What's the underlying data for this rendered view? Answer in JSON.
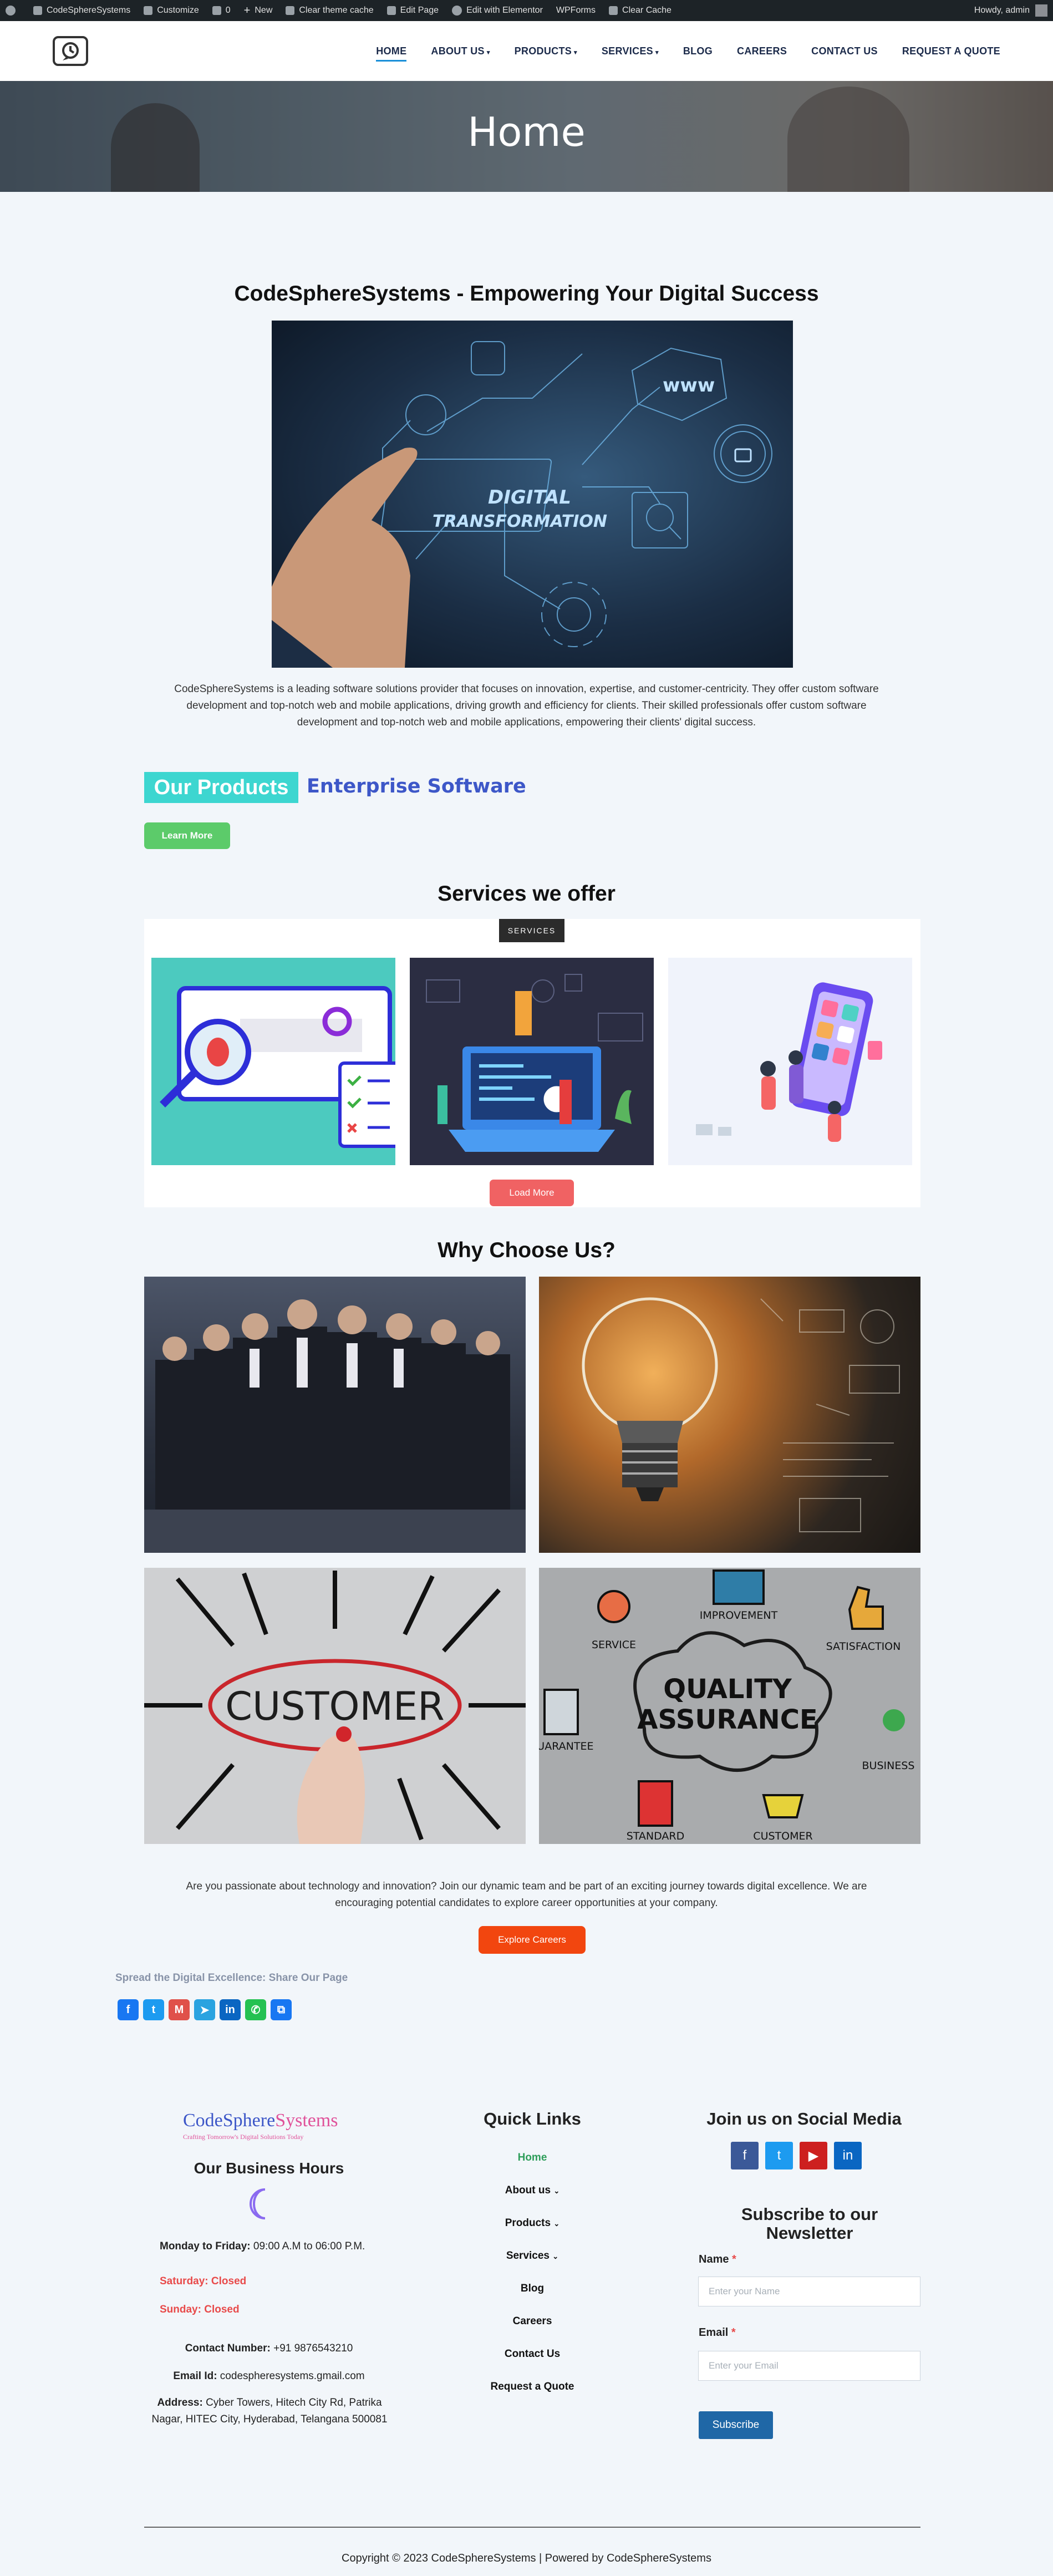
{
  "admin_bar": {
    "site_name": "CodeSphereSystems",
    "customize": "Customize",
    "comments": "0",
    "new": "New",
    "clear_theme_cache": "Clear theme cache",
    "edit_page": "Edit Page",
    "edit_elementor": "Edit with Elementor",
    "wpforms": "WPForms",
    "clear_cache": "Clear Cache",
    "howdy": "Howdy, admin"
  },
  "nav": {
    "items": [
      {
        "label": "HOME",
        "active": true
      },
      {
        "label": "ABOUT US",
        "has_dropdown": true
      },
      {
        "label": "PRODUCTS",
        "has_dropdown": true
      },
      {
        "label": "SERVICES",
        "has_dropdown": true
      },
      {
        "label": "BLOG"
      },
      {
        "label": "CAREERS"
      },
      {
        "label": "CONTACT US"
      },
      {
        "label": "REQUEST A QUOTE"
      }
    ]
  },
  "hero": {
    "title": "Home"
  },
  "main": {
    "title": "CodeSphereSystems - Empowering Your Digital Success",
    "image_text_1": "DIGITAL",
    "image_text_2": "TRANSFORMATION",
    "image_www": "www",
    "intro": "CodeSphereSystems is a leading software solutions provider that focuses on innovation, expertise, and customer-centricity. They offer custom software development and top-notch web and mobile applications, driving growth and efficiency for clients. Their skilled professionals offer custom software development and top-notch web and mobile applications, empowering their clients' digital success."
  },
  "products": {
    "badge": "Our Products",
    "headline": "Enterprise Software",
    "learn_more": "Learn More"
  },
  "services": {
    "title": "Services we offer",
    "badge": "SERVICES",
    "load_more": "Load More"
  },
  "why": {
    "title": "Why Choose Us?",
    "customer_word": "CUSTOMER",
    "qa_line1": "QUALITY",
    "qa_line2": "ASSURANCE",
    "qa_labels": [
      "SERVICE",
      "IMPROVEMENT",
      "SATISFACTION",
      "GUARANTEE",
      "BUSINESS",
      "STANDARD",
      "CUSTOMER"
    ]
  },
  "careers": {
    "text": "Are you passionate about technology and innovation? Join our dynamic team and be part of an exciting journey towards digital excellence. We are encouraging potential candidates to explore career opportunities at your company.",
    "button": "Explore Careers"
  },
  "share": {
    "title": "Spread the Digital Excellence: Share Our Page"
  },
  "footer": {
    "logo_a": "CodeSphere",
    "logo_b": "Systems",
    "tagline": "Crafting Tomorrow's Digital Solutions Today",
    "business_hours_title": "Our Business Hours",
    "weekday_label": "Monday to Friday:",
    "weekday_hours": " 09:00 A.M to 06:00 P.M.",
    "saturday": "Saturday: Closed",
    "sunday": "Sunday: Closed",
    "contact_label": "Contact Number:",
    "contact_value": " +91 9876543210",
    "email_label": "Email Id:",
    "email_value": " codespheresystems.gmail.com",
    "address_label": "Address:",
    "address_value": " Cyber Towers, Hitech City Rd, Patrika Nagar, HITEC City, Hyderabad, Telangana 500081",
    "quick_links_title": "Quick Links",
    "quick_links": [
      {
        "label": "Home",
        "active": true
      },
      {
        "label": "About us",
        "has_dropdown": true
      },
      {
        "label": "Products",
        "has_dropdown": true
      },
      {
        "label": "Services",
        "has_dropdown": true
      },
      {
        "label": "Blog"
      },
      {
        "label": "Careers"
      },
      {
        "label": "Contact Us"
      },
      {
        "label": "Request a Quote"
      }
    ],
    "social_title": "Join us on Social Media",
    "subscribe_title": "Subscribe to our Newsletter",
    "name_label": "Name",
    "name_placeholder": "Enter your Name",
    "email_field_label": "Email",
    "email_placeholder": "Enter your Email",
    "subscribe_button": "Subscribe",
    "required_mark": "*",
    "copyright": "Copyright © 2023 CodeSphereSystems | Powered by CodeSphereSystems"
  },
  "colors": {
    "accent_blue": "#1a8fd8",
    "teal": "#3dd6d0",
    "green": "#5ccb6a",
    "coral": "#f06263",
    "orange": "#f2460f",
    "quick_link_active": "#2e9e5a"
  }
}
